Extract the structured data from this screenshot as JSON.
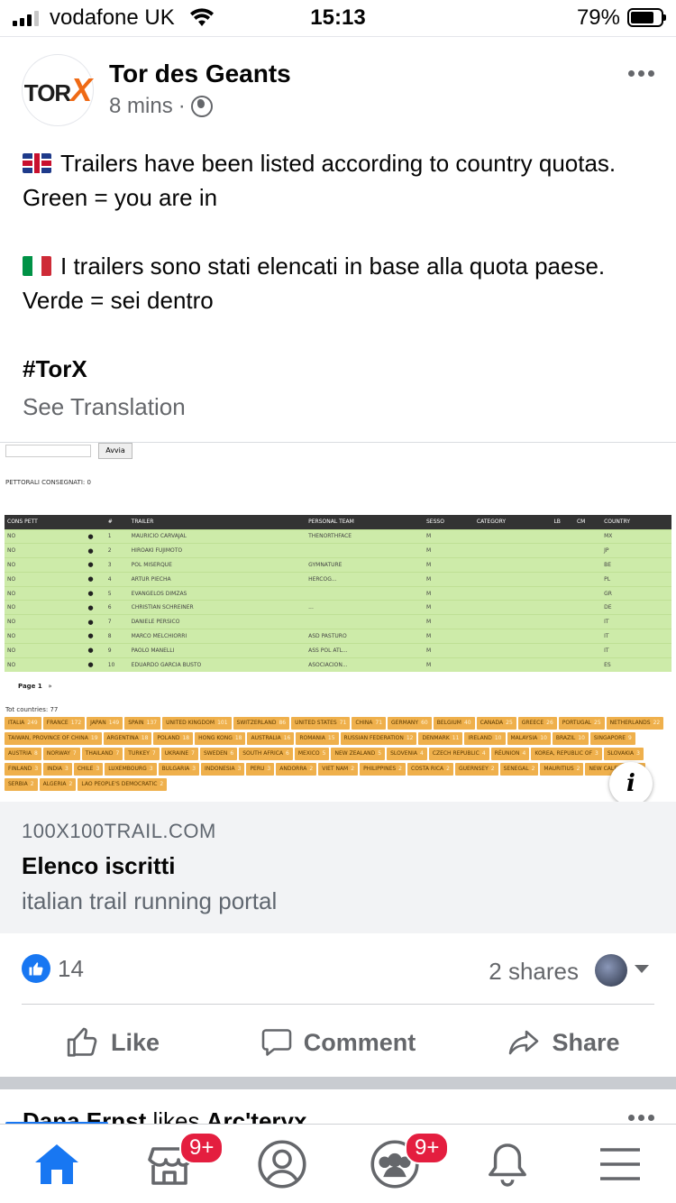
{
  "status_bar": {
    "carrier": "vodafone UK",
    "time": "15:13",
    "battery": "79%"
  },
  "post": {
    "page_name": "Tor des Geants",
    "logo": {
      "tor": "TOR",
      "x": "X"
    },
    "time_ago": "8 mins",
    "separator": "·",
    "paragraph_en": "Trailers have been listed according to country quotas. Green = you are in",
    "paragraph_it": "I trailers sono stati elencati in base alla quota paese. Verde = sei dentro",
    "hashtag": "#TorX",
    "see_translation": "See Translation"
  },
  "link_preview": {
    "domain": "100X100TRAIL.COM",
    "title": "Elenco iscritti",
    "description": "italian trail running portal",
    "info_glyph": "i",
    "screenshot": {
      "button": "Avvia",
      "consegnati": "PETTORALI CONSEGNATI: 0",
      "columns": [
        "CONS PETT",
        "",
        "#",
        "TRAILER",
        "PERSONAL TEAM",
        "SESSO",
        "CATEGORY",
        "LB",
        "CM",
        "COUNTRY"
      ],
      "rows": [
        [
          "NO",
          "1",
          "MAURICIO CARVAJAL",
          "THENORTHFACE",
          "M",
          "MX"
        ],
        [
          "NO",
          "2",
          "HIROAKI FUJIMOTO",
          "",
          "M",
          "JP"
        ],
        [
          "NO",
          "3",
          "POL MISERQUE",
          "GYMNATURE",
          "M",
          "BE"
        ],
        [
          "NO",
          "4",
          "ARTUR PIECHA",
          "HERCOG...",
          "M",
          "PL"
        ],
        [
          "NO",
          "5",
          "EVANGELOS DIMZAS",
          "",
          "M",
          "GR"
        ],
        [
          "NO",
          "6",
          "CHRISTIAN SCHREINER",
          "...",
          "M",
          "DE"
        ],
        [
          "NO",
          "7",
          "DANIELE PERSICO",
          "",
          "M",
          "IT"
        ],
        [
          "NO",
          "8",
          "MARCO MELCHIORRI",
          "ASD PASTURO",
          "M",
          "IT"
        ],
        [
          "NO",
          "9",
          "PAOLO MANELLI",
          "ASS POL ATL...",
          "M",
          "IT"
        ],
        [
          "NO",
          "10",
          "EDUARDO GARCIA BUSTO",
          "ASOCIACION...",
          "M",
          "ES"
        ]
      ],
      "page_label": "Page 1",
      "page_next": "»",
      "tot_countries": "Tot countries: 77",
      "countries": [
        [
          "ITALIA",
          "249"
        ],
        [
          "FRANCE",
          "172"
        ],
        [
          "JAPAN",
          "149"
        ],
        [
          "SPAIN",
          "137"
        ],
        [
          "UNITED KINGDOM",
          "101"
        ],
        [
          "SWITZERLAND",
          "86"
        ],
        [
          "UNITED STATES",
          "71"
        ],
        [
          "CHINA",
          "71"
        ],
        [
          "GERMANY",
          "60"
        ],
        [
          "BELGIUM",
          "40"
        ],
        [
          "CANADA",
          "25"
        ],
        [
          "GREECE",
          "26"
        ],
        [
          "PORTUGAL",
          "25"
        ],
        [
          "NETHERLANDS",
          "22"
        ],
        [
          "TAIWAN, PROVINCE OF CHINA",
          "19"
        ],
        [
          "ARGENTINA",
          "18"
        ],
        [
          "POLAND",
          "18"
        ],
        [
          "HONG KONG",
          "18"
        ],
        [
          "AUSTRALIA",
          "16"
        ],
        [
          "ROMANIA",
          "15"
        ],
        [
          "RUSSIAN FEDERATION",
          "12"
        ],
        [
          "DENMARK",
          "11"
        ],
        [
          "IRELAND",
          "10"
        ],
        [
          "MALAYSIA",
          "10"
        ],
        [
          "BRAZIL",
          "10"
        ],
        [
          "SINGAPORE",
          "9"
        ],
        [
          "AUSTRIA",
          "8"
        ],
        [
          "NORWAY",
          "7"
        ],
        [
          "THAILAND",
          "7"
        ],
        [
          "TURKEY",
          "7"
        ],
        [
          "UKRAINE",
          "7"
        ],
        [
          "SWEDEN",
          "6"
        ],
        [
          "SOUTH AFRICA",
          "6"
        ],
        [
          "MEXICO",
          "5"
        ],
        [
          "NEW ZEALAND",
          "5"
        ],
        [
          "SLOVENIA",
          "4"
        ],
        [
          "CZECH REPUBLIC",
          "4"
        ],
        [
          "RÉUNION",
          "4"
        ],
        [
          "KOREA, REPUBLIC OF",
          "3"
        ],
        [
          "SLOVAKIA",
          "3"
        ],
        [
          "FINLAND",
          "3"
        ],
        [
          "INDIA",
          "3"
        ],
        [
          "CHILE",
          "3"
        ],
        [
          "LUXEMBOURG",
          "3"
        ],
        [
          "BULGARIA",
          "3"
        ],
        [
          "INDONESIA",
          "3"
        ],
        [
          "PERU",
          "3"
        ],
        [
          "ANDORRA",
          "2"
        ],
        [
          "VIET NAM",
          "2"
        ],
        [
          "PHILIPPINES",
          "2"
        ],
        [
          "COSTA RICA",
          "2"
        ],
        [
          "GUERNSEY",
          "2"
        ],
        [
          "SENEGAL",
          "2"
        ],
        [
          "MAURITIUS",
          "2"
        ],
        [
          "NEW CALEDONIA",
          "2"
        ],
        [
          "SERBIA",
          "2"
        ],
        [
          "ALGERIA",
          "2"
        ],
        [
          "LAO PEOPLE'S DEMOCRATIC",
          "2"
        ]
      ]
    }
  },
  "reactions": {
    "likes": "14",
    "shares": "2 shares"
  },
  "actions": {
    "like": "Like",
    "comment": "Comment",
    "share": "Share"
  },
  "next_post": {
    "actor": "Dana Ernst",
    "verb": "likes",
    "target": "Arc'teryx"
  },
  "bottom_nav": {
    "marketplace_badge": "9+",
    "groups_badge": "9+"
  },
  "colors": {
    "accent": "#1877f2",
    "badge": "#e41e3f",
    "green_row": "#cdeba9",
    "country_tag": "#efb04c"
  },
  "icons": [
    "signal-icon",
    "wifi-icon",
    "battery-icon",
    "globe-icon",
    "more-icon",
    "uk-flag-icon",
    "italy-flag-icon",
    "info-icon",
    "like-reaction-icon",
    "thumbs-up-icon",
    "comment-icon",
    "share-arrow-icon",
    "home-icon",
    "marketplace-icon",
    "profile-icon",
    "groups-icon",
    "bell-icon",
    "menu-icon"
  ]
}
